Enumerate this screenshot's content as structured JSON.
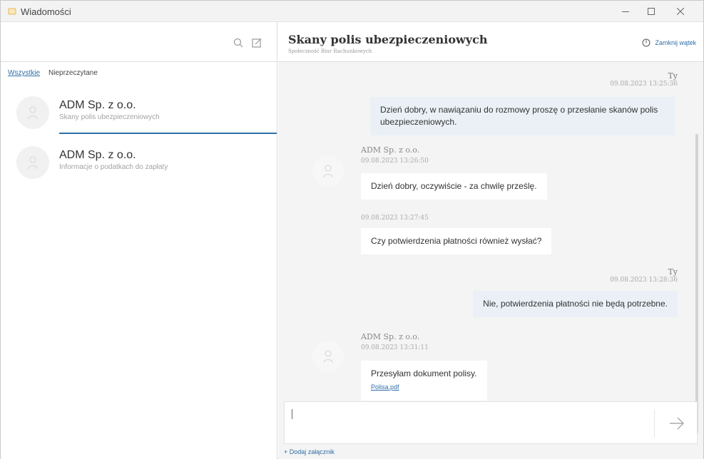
{
  "window": {
    "title": "Wiadomości",
    "min_icon": "minimize-icon",
    "max_icon": "maximize-icon",
    "close_icon": "close-icon"
  },
  "sidebar": {
    "search_icon": "search-icon",
    "compose_icon": "compose-icon",
    "filters": {
      "all": "Wszystkie",
      "unread": "Nieprzeczytane"
    },
    "conversations": [
      {
        "name": "ADM Sp. z o.o.",
        "subject": "Skany polis ubezpieczeniowych",
        "avatar_icon": "user-icon",
        "selected": true
      },
      {
        "name": "ADM Sp. z o.o.",
        "subject": "Informacje o podatkach do zapłaty",
        "avatar_icon": "user-icon",
        "selected": false
      }
    ]
  },
  "chat": {
    "title": "Skany polis ubezpieczeniowych",
    "subtitle": "Społeczność Biur Rachunkowych",
    "close_thread_label": "Zamknij wątek",
    "close_thread_icon": "power-icon",
    "messages": [
      {
        "direction": "out",
        "sender": "Ty",
        "time": "09.08.2023 13:25:36",
        "text": "Dzień dobry, w nawiązaniu do rozmowy proszę o przesłanie skanów polis ubezpieczeniowych."
      },
      {
        "direction": "in",
        "sender": "ADM Sp. z o.o.",
        "time": "09.08.2023 13:26:50",
        "text": "Dzień dobry, oczywiście - za chwilę prześlę."
      },
      {
        "direction": "in",
        "sender": "",
        "time": "09.08.2023 13:27:45",
        "text": "Czy potwierdzenia płatności również wysłać?"
      },
      {
        "direction": "out",
        "sender": "Ty",
        "time": "09.08.2023 13:28:36",
        "text": "Nie, potwierdzenia płatności nie będą potrzebne."
      },
      {
        "direction": "in",
        "sender": "ADM Sp. z o.o.",
        "time": "09.08.2023 13:31:11",
        "text": "Przesyłam dokument polisy.",
        "attachment": "Polisa.pdf"
      }
    ],
    "composer": {
      "value": "",
      "send_icon": "send-arrow-icon",
      "add_attachment_label": "+ Dodaj załącznik"
    }
  },
  "colors": {
    "accent": "#2f6fa8",
    "outgoing_bubble": "#eaf0f6",
    "incoming_bubble": "#ffffff",
    "chat_background": "#f4f4f4"
  }
}
